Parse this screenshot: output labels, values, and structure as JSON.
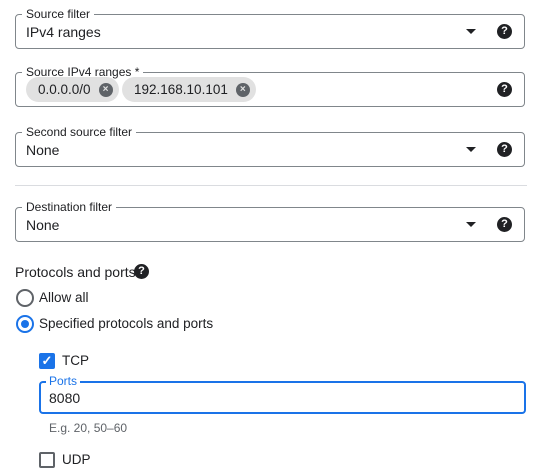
{
  "source_filter": {
    "label": "Source filter",
    "value": "IPv4 ranges",
    "help": "?"
  },
  "source_ranges": {
    "label": "Source IPv4 ranges *",
    "chips": [
      "0.0.0.0/0",
      "192.168.10.101"
    ],
    "chip_close": "×",
    "help": "?"
  },
  "second_source_filter": {
    "label": "Second source filter",
    "value": "None",
    "help": "?"
  },
  "destination_filter": {
    "label": "Destination filter",
    "value": "None",
    "help": "?"
  },
  "protocols": {
    "title": "Protocols and ports",
    "help": "?",
    "options": [
      {
        "label": "Allow all",
        "selected": false
      },
      {
        "label": "Specified protocols and ports",
        "selected": true
      }
    ],
    "tcp": {
      "label": "TCP",
      "checked": true,
      "check_glyph": "✓"
    },
    "ports": {
      "label": "Ports",
      "value": "8080",
      "hint": "E.g. 20, 50–60"
    },
    "udp": {
      "label": "UDP",
      "checked": false
    }
  },
  "colors": {
    "accent": "#1a73e8",
    "border": "#80868b",
    "chip": "#e1e1e1"
  }
}
